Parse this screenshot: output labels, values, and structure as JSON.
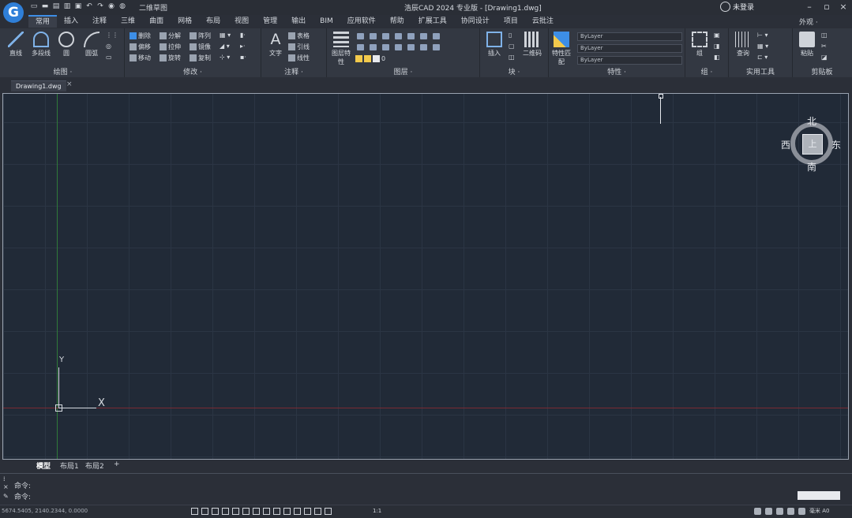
{
  "app": {
    "logo_letter": "G",
    "title": "浩辰CAD 2024 专业版 - [Drawing1.dwg]",
    "workspace": "二维草图",
    "login": "未登录",
    "appearance": "外观 ·",
    "accent": "#3d8ee6"
  },
  "menu_tabs": [
    "常用",
    "插入",
    "注释",
    "三维",
    "曲面",
    "网格",
    "布局",
    "视图",
    "管理",
    "输出",
    "BIM",
    "应用软件",
    "帮助",
    "扩展工具",
    "协同设计",
    "项目",
    "云批注"
  ],
  "active_tab": "常用",
  "ribbon": {
    "draw": {
      "label": "绘图 ·",
      "line": "直线",
      "pline": "多段线",
      "circle": "圆",
      "arc": "圆弧"
    },
    "modify": {
      "label": "修改 ·",
      "erase": "删除",
      "explode": "分解",
      "array": "阵列",
      "copy_move": "偏移",
      "stretch": "拉伸",
      "mirror": "镜像",
      "move": "移动",
      "rotate": "旋转",
      "copy": "复制"
    },
    "annotate": {
      "label": "注释 ·",
      "text": "文字",
      "table": "表格",
      "leader": "引线",
      "linear": "线性"
    },
    "layers": {
      "label": "图层 ·",
      "props": "图层特性",
      "current": "0"
    },
    "block": {
      "label": "块 ·",
      "insert": "插入",
      "qrcode": "二维码"
    },
    "properties": {
      "label": "特性 ·",
      "match": "特性匹配",
      "color": "ByLayer",
      "linetype": "ByLayer",
      "lineweight": "ByLayer"
    },
    "group": {
      "label": "组 ·",
      "group": "组"
    },
    "utilities": {
      "label": "实用工具",
      "measure": "查询"
    },
    "clipboard": {
      "label": "剪贴板",
      "paste": "粘贴"
    }
  },
  "document_tab": "Drawing1.dwg",
  "document_tab_close": "×",
  "viewcube": {
    "top": "上",
    "north": "北",
    "south": "南",
    "east": "东",
    "west": "西"
  },
  "ucs": {
    "x": "X",
    "y": "Y"
  },
  "layout_tabs": [
    "模型",
    "布局1",
    "布局2",
    "+"
  ],
  "command": {
    "line1": "命令:",
    "line2": "命令:"
  },
  "status": {
    "coords": "5674.5405, 2140.2344, 0.0000",
    "scale": "1:1",
    "unit": "毫米 A0"
  }
}
